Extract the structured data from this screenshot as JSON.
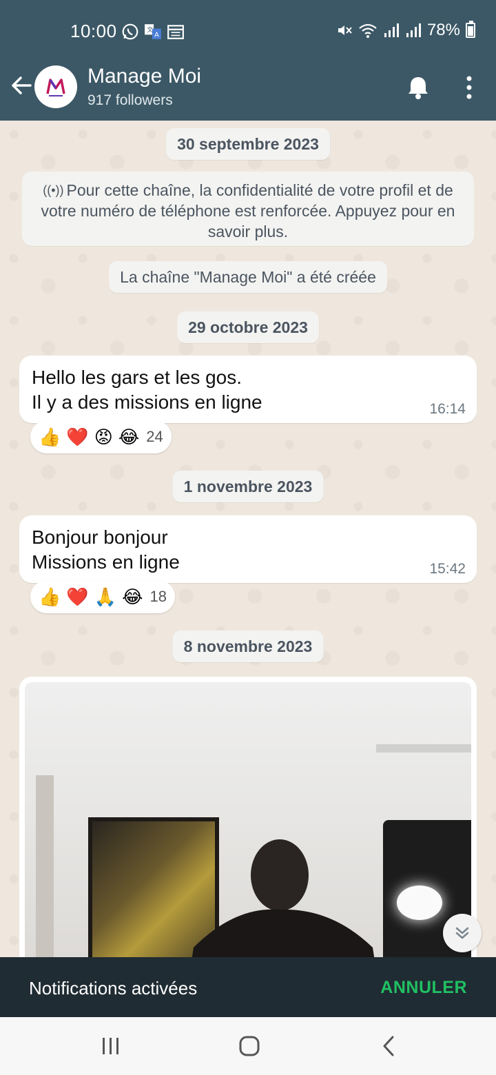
{
  "status": {
    "time": "10:00",
    "battery": "78%",
    "battery_level": 0.78
  },
  "header": {
    "title": "Manage Moi",
    "subtitle": "917 followers",
    "logo_text": "M"
  },
  "chat": {
    "date1": "30 septembre 2023",
    "notice_icon": "((•))",
    "notice": "Pour cette chaîne, la confidentialité de votre profil et de votre numéro de téléphone est renforcée. Appuyez pour en savoir plus.",
    "created": "La chaîne \"Manage Moi\" a été créée",
    "date2": "29 octobre 2023",
    "msg1": {
      "line1": "Hello les gars et les gos.",
      "line2": "Il y a des missions en ligne",
      "time": "16:14",
      "reactions": [
        "👍",
        "❤️",
        "😡",
        "😂"
      ],
      "count": "24"
    },
    "date3": "1 novembre 2023",
    "msg2": {
      "line1": "Bonjour bonjour",
      "line2": "Missions en ligne",
      "time": "15:42",
      "reactions": [
        "👍",
        "❤️",
        "🙏",
        "😂"
      ],
      "count": "18"
    },
    "date4": "8 novembre 2023"
  },
  "snackbar": {
    "message": "Notifications activées",
    "action": "ANNULER"
  },
  "colors": {
    "header": "#3c5866",
    "snackbar": "#202c33",
    "accent": "#21c063"
  }
}
